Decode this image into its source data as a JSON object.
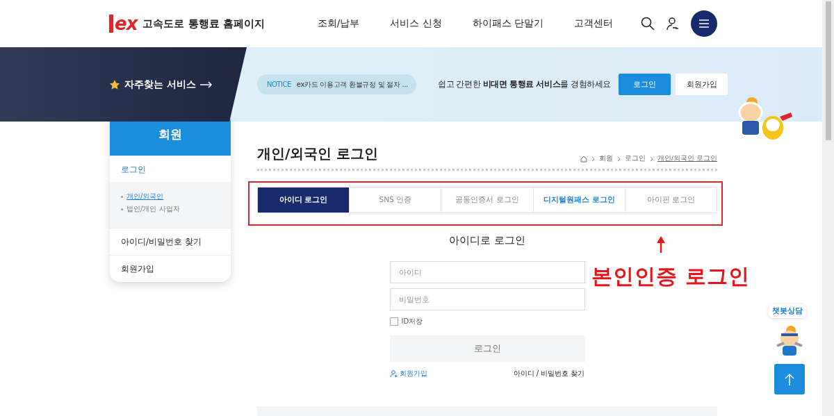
{
  "header": {
    "logo_mark": "ex",
    "site_title": "고속도로 통행료 홈페이지",
    "nav": [
      "조회/납부",
      "서비스 신청",
      "하이패스 단말기",
      "고객센터"
    ]
  },
  "banner": {
    "favorites": "자주찾는 서비스",
    "notice": {
      "label": "NOTICE",
      "text": "ex카드 이용고객 환불규정 및 절차 ..."
    },
    "promo": "쉽고 간편한 **비대면 통행료 서비스**를 경험하세요",
    "buttons": [
      {
        "label": "로그인",
        "kind": "primary"
      },
      {
        "label": "회원가입",
        "kind": "secondary"
      }
    ]
  },
  "sidebar": {
    "title": "회원",
    "items": [
      {
        "label": "로그인",
        "selected": true,
        "children": [
          {
            "label": "개인/외국인",
            "selected": true
          },
          {
            "label": "법인/개인 사업자",
            "selected": false
          }
        ]
      },
      {
        "label": "아이디/비밀번호 찾기",
        "selected": false
      },
      {
        "label": "회원가입",
        "selected": false
      }
    ]
  },
  "page": {
    "title": "개인/외국인 로그인",
    "breadcrumb": [
      "회원",
      "로그인",
      "개인/외국인 로그인"
    ]
  },
  "tabs": [
    {
      "label": "아이디 로그인",
      "selected": true,
      "highlighted": false
    },
    {
      "label": "SNS 인증",
      "selected": false,
      "highlighted": false
    },
    {
      "label": "공동인증서 로그인",
      "selected": false,
      "highlighted": false
    },
    {
      "label": "디지털원패스 로그인",
      "selected": false,
      "highlighted": true
    },
    {
      "label": "아이핀 로그인",
      "selected": false,
      "highlighted": false
    }
  ],
  "login_form": {
    "title": "아이디로 로그인",
    "fields": [
      {
        "placeholder": "아이디"
      },
      {
        "placeholder": "비밀번호"
      }
    ],
    "remember": {
      "label": "ID저장",
      "checked": false
    },
    "submit": "로그인",
    "signup_link": "회원가입",
    "find_link": "아이디 / 비밀번호 찾기"
  },
  "annotation": {
    "text": "본인인증 로그인"
  },
  "chatbot": {
    "label": "챗봇상담"
  }
}
